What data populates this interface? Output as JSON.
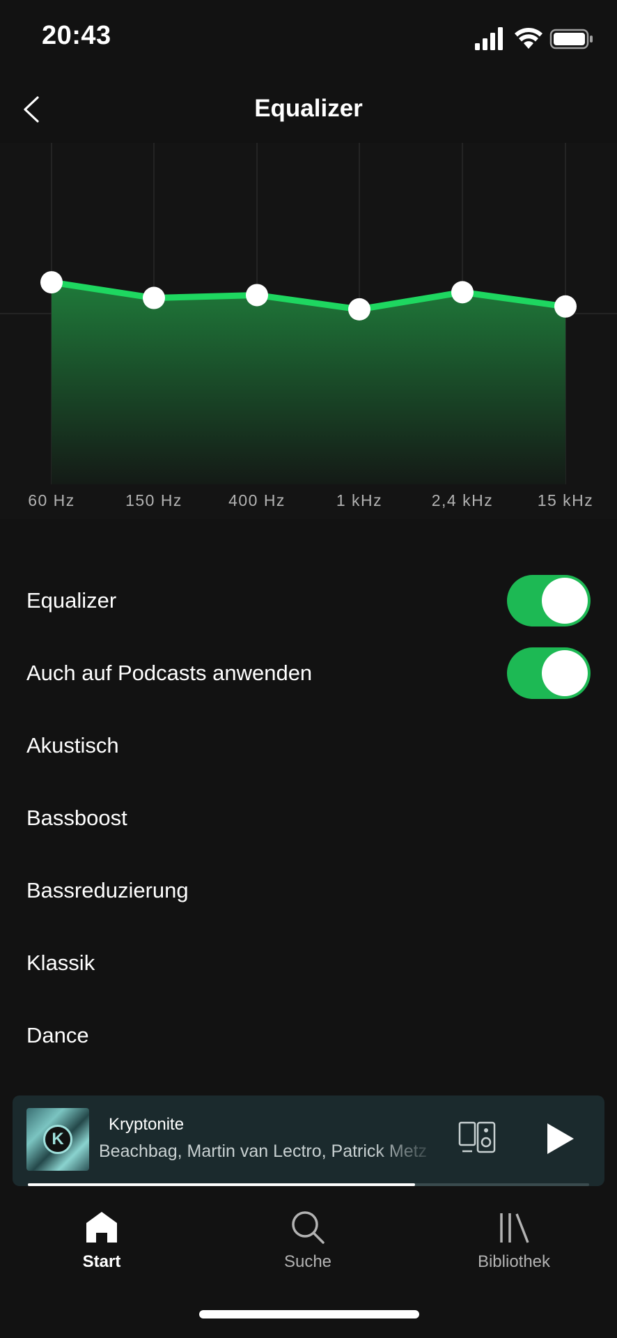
{
  "status_bar": {
    "time": "20:43",
    "icons": [
      "signal-icon",
      "wifi-icon",
      "battery-icon"
    ]
  },
  "header": {
    "title": "Equalizer",
    "back_icon": "chevron-left-icon"
  },
  "chart_data": {
    "type": "area",
    "categories": [
      "60 Hz",
      "150 Hz",
      "400 Hz",
      "1 kHz",
      "2,4 kHz",
      "15 kHz"
    ],
    "series": [
      {
        "values": [
          2.2,
          1.1,
          1.3,
          0.3,
          1.5,
          0.5
        ]
      }
    ],
    "ylim": [
      -12,
      12
    ],
    "grid": true,
    "colors": {
      "line": "#1ed760",
      "fill_top": "#1f7a3a",
      "fill_bottom": "#141a16",
      "point": "#ffffff",
      "grid": "#2a2a2a"
    }
  },
  "settings": {
    "equalizer_toggle": {
      "label": "Equalizer",
      "on": true
    },
    "podcasts_toggle": {
      "label": "Auch auf Podcasts anwenden",
      "on": true
    },
    "presets": [
      "Akustisch",
      "Bassboost",
      "Bassreduzierung",
      "Klassik",
      "Dance"
    ]
  },
  "now_playing": {
    "title": "Kryptonite",
    "artists": "Beachbag, Martin van Lectro, Patrick Metz",
    "progress": 0.69,
    "devices_icon": "devices-icon",
    "play_icon": "play-icon"
  },
  "bottom_nav": {
    "items": [
      {
        "label": "Start",
        "icon": "home-icon",
        "active": true
      },
      {
        "label": "Suche",
        "icon": "search-icon",
        "active": false
      },
      {
        "label": "Bibliothek",
        "icon": "library-icon",
        "active": false
      }
    ]
  },
  "theme": {
    "accent": "#1db954",
    "background": "#121212"
  }
}
